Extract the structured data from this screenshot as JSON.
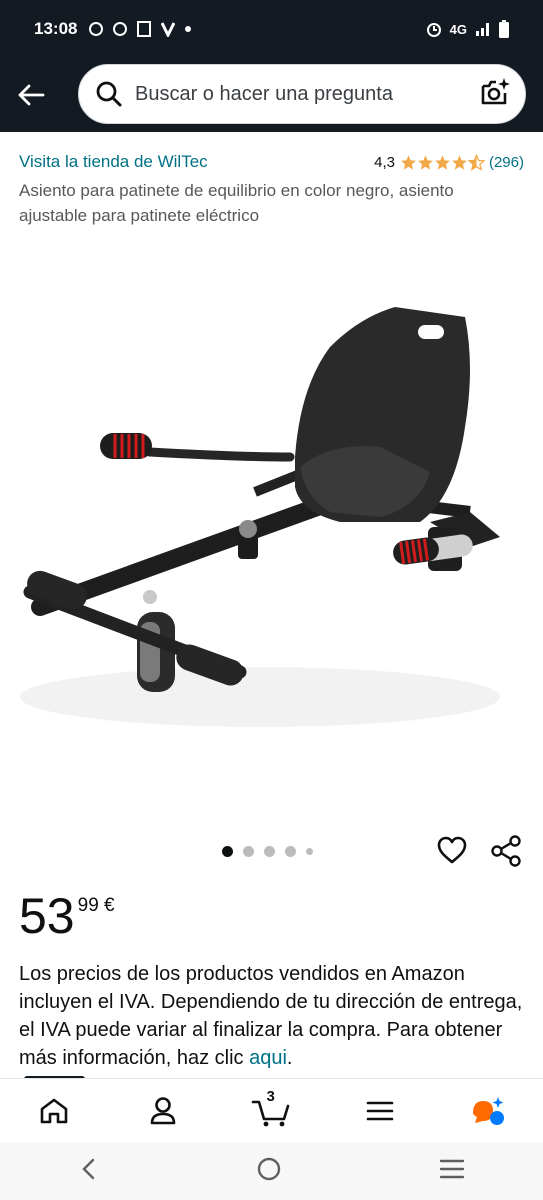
{
  "status": {
    "time": "13:08",
    "network": "4G"
  },
  "search": {
    "placeholder": "Buscar o hacer una pregunta"
  },
  "product": {
    "store_link": "Visita la tienda de WilTec",
    "rating_value": "4,3",
    "rating_stars": 4.3,
    "rating_count": "(296)",
    "title": "Asiento para patinete de equilibrio en color negro, asiento ajustable para patinete eléctrico",
    "image_count": 5,
    "active_image": 1
  },
  "price": {
    "whole": "53",
    "fraction": "99 €"
  },
  "vat_notice": {
    "text": "Los precios de los productos vendidos en Amazon incluyen el IVA. Dependiendo de tu dirección de entrega, el IVA puede variar al finalizar la compra. Para obtener más información, haz clic ",
    "link": "aqui",
    "end": "."
  },
  "nav": {
    "items": [
      "home-icon",
      "account-icon",
      "cart-icon",
      "menu-icon",
      "rufus-icon"
    ],
    "cart_count": "3"
  },
  "colors": {
    "header_bg": "#131a22",
    "link": "#007185",
    "star": "#f3a847",
    "rufus_orange": "#ff6a00",
    "rufus_blue": "#007aff"
  }
}
